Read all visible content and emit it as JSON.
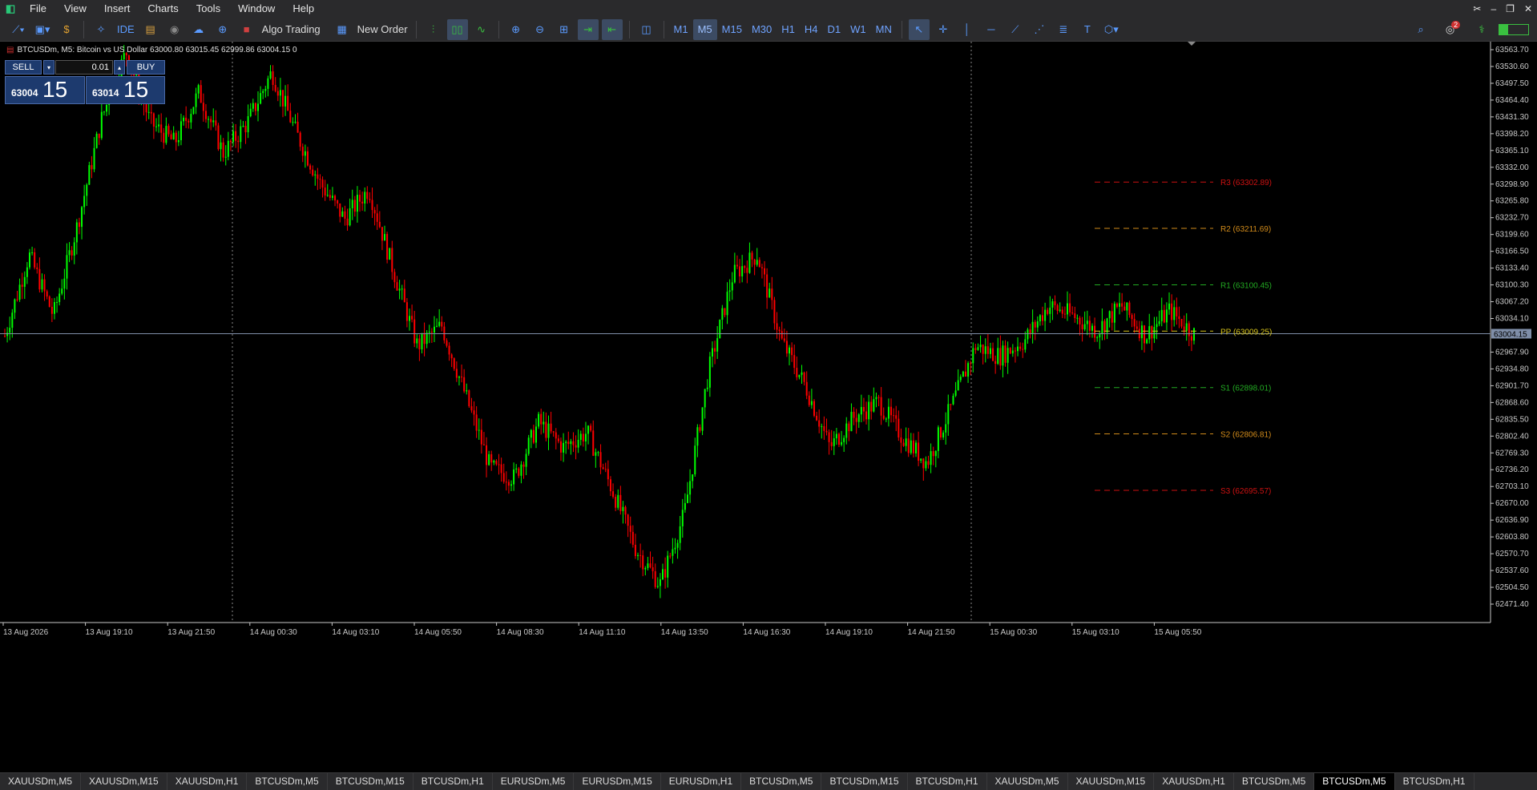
{
  "menu": {
    "items": [
      "File",
      "View",
      "Insert",
      "Charts",
      "Tools",
      "Window",
      "Help"
    ]
  },
  "toolbar": {
    "algo_trading": "Algo Trading",
    "new_order": "New Order",
    "ide": "IDE",
    "timeframes": [
      "M1",
      "M5",
      "M15",
      "M30",
      "H1",
      "H4",
      "D1",
      "W1",
      "MN"
    ],
    "active_timeframe": "M5",
    "notification_count": "2"
  },
  "chart": {
    "symbol_line": "BTCUSDm, M5:  Bitcoin vs US Dollar  63000.80 63015.45 62999.86 63004.15  0",
    "trade": {
      "sell_label": "SELL",
      "buy_label": "BUY",
      "volume": "0.01",
      "sell_small": "63004",
      "sell_big": "15",
      "buy_small": "63014",
      "buy_big": "15"
    },
    "current_price_label": "63004.15",
    "colors": {
      "bull": "#00ff00",
      "bear": "#ff0000",
      "background": "#000000"
    }
  },
  "chart_data": {
    "type": "candlestick",
    "y_ticks": [
      63563.7,
      63530.6,
      63497.5,
      63464.4,
      63431.3,
      63398.2,
      63365.1,
      63332.0,
      63298.9,
      63265.8,
      63232.7,
      63199.6,
      63166.5,
      63133.4,
      63100.3,
      63067.2,
      63034.1,
      62967.9,
      62934.8,
      62901.7,
      62868.6,
      62835.5,
      62802.4,
      62769.3,
      62736.2,
      62703.1,
      62670.0,
      62636.9,
      62603.8,
      62570.7,
      62537.6,
      62504.5,
      62471.4
    ],
    "y_tick_labels": [
      "63563.70",
      "63530.60",
      "63497.50",
      "63464.40",
      "63431.30",
      "63398.20",
      "63365.10",
      "63332.00",
      "63298.90",
      "63265.80",
      "63232.70",
      "63199.60",
      "63166.50",
      "63133.40",
      "63100.30",
      "63067.20",
      "63034.10",
      "62967.90",
      "62934.80",
      "62901.70",
      "62868.60",
      "62835.50",
      "62802.40",
      "62769.30",
      "62736.20",
      "62703.10",
      "62670.00",
      "62636.90",
      "62603.80",
      "62570.70",
      "62537.60",
      "62504.50",
      "62471.40"
    ],
    "x_labels": [
      "13 Aug 2026",
      "13 Aug 19:10",
      "13 Aug 21:50",
      "14 Aug 00:30",
      "14 Aug 03:10",
      "14 Aug 05:50",
      "14 Aug 08:30",
      "14 Aug 11:10",
      "14 Aug 13:50",
      "14 Aug 16:30",
      "14 Aug 19:10",
      "14 Aug 21:50",
      "15 Aug 00:30",
      "15 Aug 03:10",
      "15 Aug 05:50"
    ],
    "pivot_levels": [
      {
        "label": "R3 (63302.89)",
        "value": 63302.89,
        "color": "#cc1111"
      },
      {
        "label": "R2 (63211.69)",
        "value": 63211.69,
        "color": "#d08a1a"
      },
      {
        "label": "R1 (63100.45)",
        "value": 63100.45,
        "color": "#22aa22"
      },
      {
        "label": "PP (63009.25)",
        "value": 63009.25,
        "color": "#d6c21a"
      },
      {
        "label": "S1 (62898.01)",
        "value": 62898.01,
        "color": "#22aa22"
      },
      {
        "label": "S2 (62806.81)",
        "value": 62806.81,
        "color": "#d08a1a"
      },
      {
        "label": "S3 (62695.57)",
        "value": 62695.57,
        "color": "#cc1111"
      }
    ],
    "current_price": 63004.15,
    "price_path": [
      63000,
      63160,
      63040,
      63220,
      63430,
      63560,
      63420,
      63380,
      63480,
      63360,
      63420,
      63520,
      63400,
      63300,
      63230,
      63290,
      63130,
      62980,
      63020,
      62880,
      62740,
      62720,
      62830,
      62780,
      62810,
      62700,
      62580,
      62510,
      62650,
      62930,
      63120,
      63160,
      62990,
      62900,
      62780,
      62840,
      62870,
      62800,
      62750,
      62860,
      62980,
      62960,
      62990,
      63060,
      63040,
      63010,
      63060,
      63000,
      63050,
      63004
    ]
  },
  "tabs": {
    "items": [
      "XAUUSDm,M5",
      "XAUUSDm,M15",
      "XAUUSDm,H1",
      "BTCUSDm,M5",
      "BTCUSDm,M15",
      "BTCUSDm,H1",
      "EURUSDm,M5",
      "EURUSDm,M15",
      "EURUSDm,H1",
      "BTCUSDm,M5",
      "BTCUSDm,M15",
      "BTCUSDm,H1",
      "XAUUSDm,M5",
      "XAUUSDm,M15",
      "XAUUSDm,H1",
      "BTCUSDm,M5",
      "BTCUSDm,M5",
      "BTCUSDm,H1"
    ],
    "active_index": 16
  }
}
